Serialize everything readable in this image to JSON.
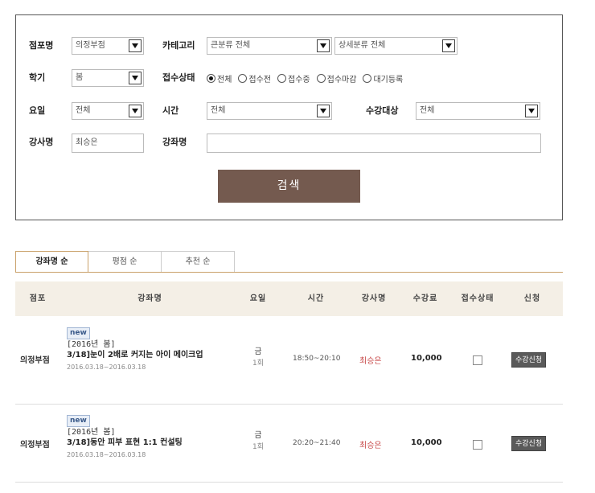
{
  "search": {
    "branch_label": "점포명",
    "branch_value": "의정부점",
    "category_label": "카테고리",
    "category_major": "큰분류 전체",
    "category_minor": "상세분류 전체",
    "term_label": "학기",
    "term_value": "봄",
    "status_label": "접수상태",
    "status_options": [
      {
        "label": "전체",
        "selected": true
      },
      {
        "label": "접수전",
        "selected": false
      },
      {
        "label": "접수중",
        "selected": false
      },
      {
        "label": "접수마감",
        "selected": false
      },
      {
        "label": "대기등록",
        "selected": false
      }
    ],
    "day_label": "요일",
    "day_value": "전체",
    "time_label": "시간",
    "time_value": "전체",
    "target_label": "수강대상",
    "target_value": "전체",
    "teacher_label": "강사명",
    "teacher_value": "최승은",
    "course_label": "강좌명",
    "course_value": "",
    "submit_label": "검색"
  },
  "tabs": [
    {
      "label": "강좌명 순",
      "active": true
    },
    {
      "label": "평점 순",
      "active": false
    },
    {
      "label": "추천 순",
      "active": false
    }
  ],
  "table": {
    "headers": [
      "점포",
      "강좌명",
      "요일",
      "시간",
      "강사명",
      "수강료",
      "접수상태",
      "신청"
    ],
    "rows": [
      {
        "branch": "의정부점",
        "badge": "new",
        "course_sub": "[2016년 봄]",
        "course_title": "3/18]눈이 2배로 커지는 아이 메이크업",
        "course_date": "2016.03.18~2016.03.18",
        "day": "금",
        "count": "1회",
        "time": "18:50~20:10",
        "teacher": "최승은",
        "fee": "10,000",
        "apply": "수강신청"
      },
      {
        "branch": "의정부점",
        "badge": "new",
        "course_sub": "[2016년 봄]",
        "course_title": "3/18]동안 피부 표현 1:1 컨설팅",
        "course_date": "2016.03.18~2016.03.18",
        "day": "금",
        "count": "1회",
        "time": "20:20~21:40",
        "teacher": "최승은",
        "fee": "10,000",
        "apply": "수강신청"
      }
    ]
  }
}
